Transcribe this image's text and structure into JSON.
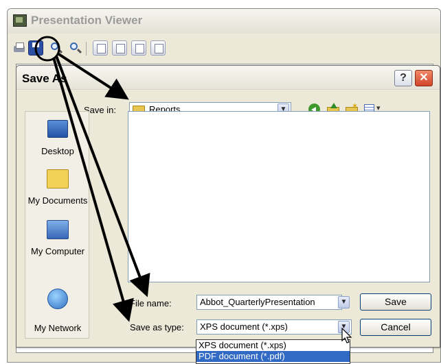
{
  "viewer": {
    "title": "Presentation Viewer",
    "toolbar_icons": [
      "print-icon",
      "save-icon",
      "zoom-in-icon",
      "zoom-out-icon",
      "page-view-icon",
      "page-view-icon",
      "page-view-icon",
      "page-view-icon"
    ]
  },
  "dialog": {
    "title": "Save As",
    "help_label": "?",
    "close_label": "✕",
    "save_in_label": "Save in:",
    "save_in_value": "Reports",
    "places": [
      {
        "label": "Desktop",
        "icon": "desktop-icon"
      },
      {
        "label": "My Documents",
        "icon": "my-documents-icon"
      },
      {
        "label": "My Computer",
        "icon": "my-computer-icon"
      },
      {
        "label": "My Network",
        "icon": "my-network-icon"
      }
    ],
    "file_name_label": "File name:",
    "file_name_value": "Abbot_QuarterlyPresentation",
    "save_as_type_label": "Save as type:",
    "save_as_type_value": "XPS document (*.xps)",
    "type_options": [
      "XPS document (*.xps)",
      "PDF document (*.pdf)"
    ],
    "save_button": "Save",
    "cancel_button": "Cancel"
  },
  "colors": {
    "dialog_bg": "#ece9d8",
    "selection": "#316ac5",
    "annotation": "#000000"
  }
}
